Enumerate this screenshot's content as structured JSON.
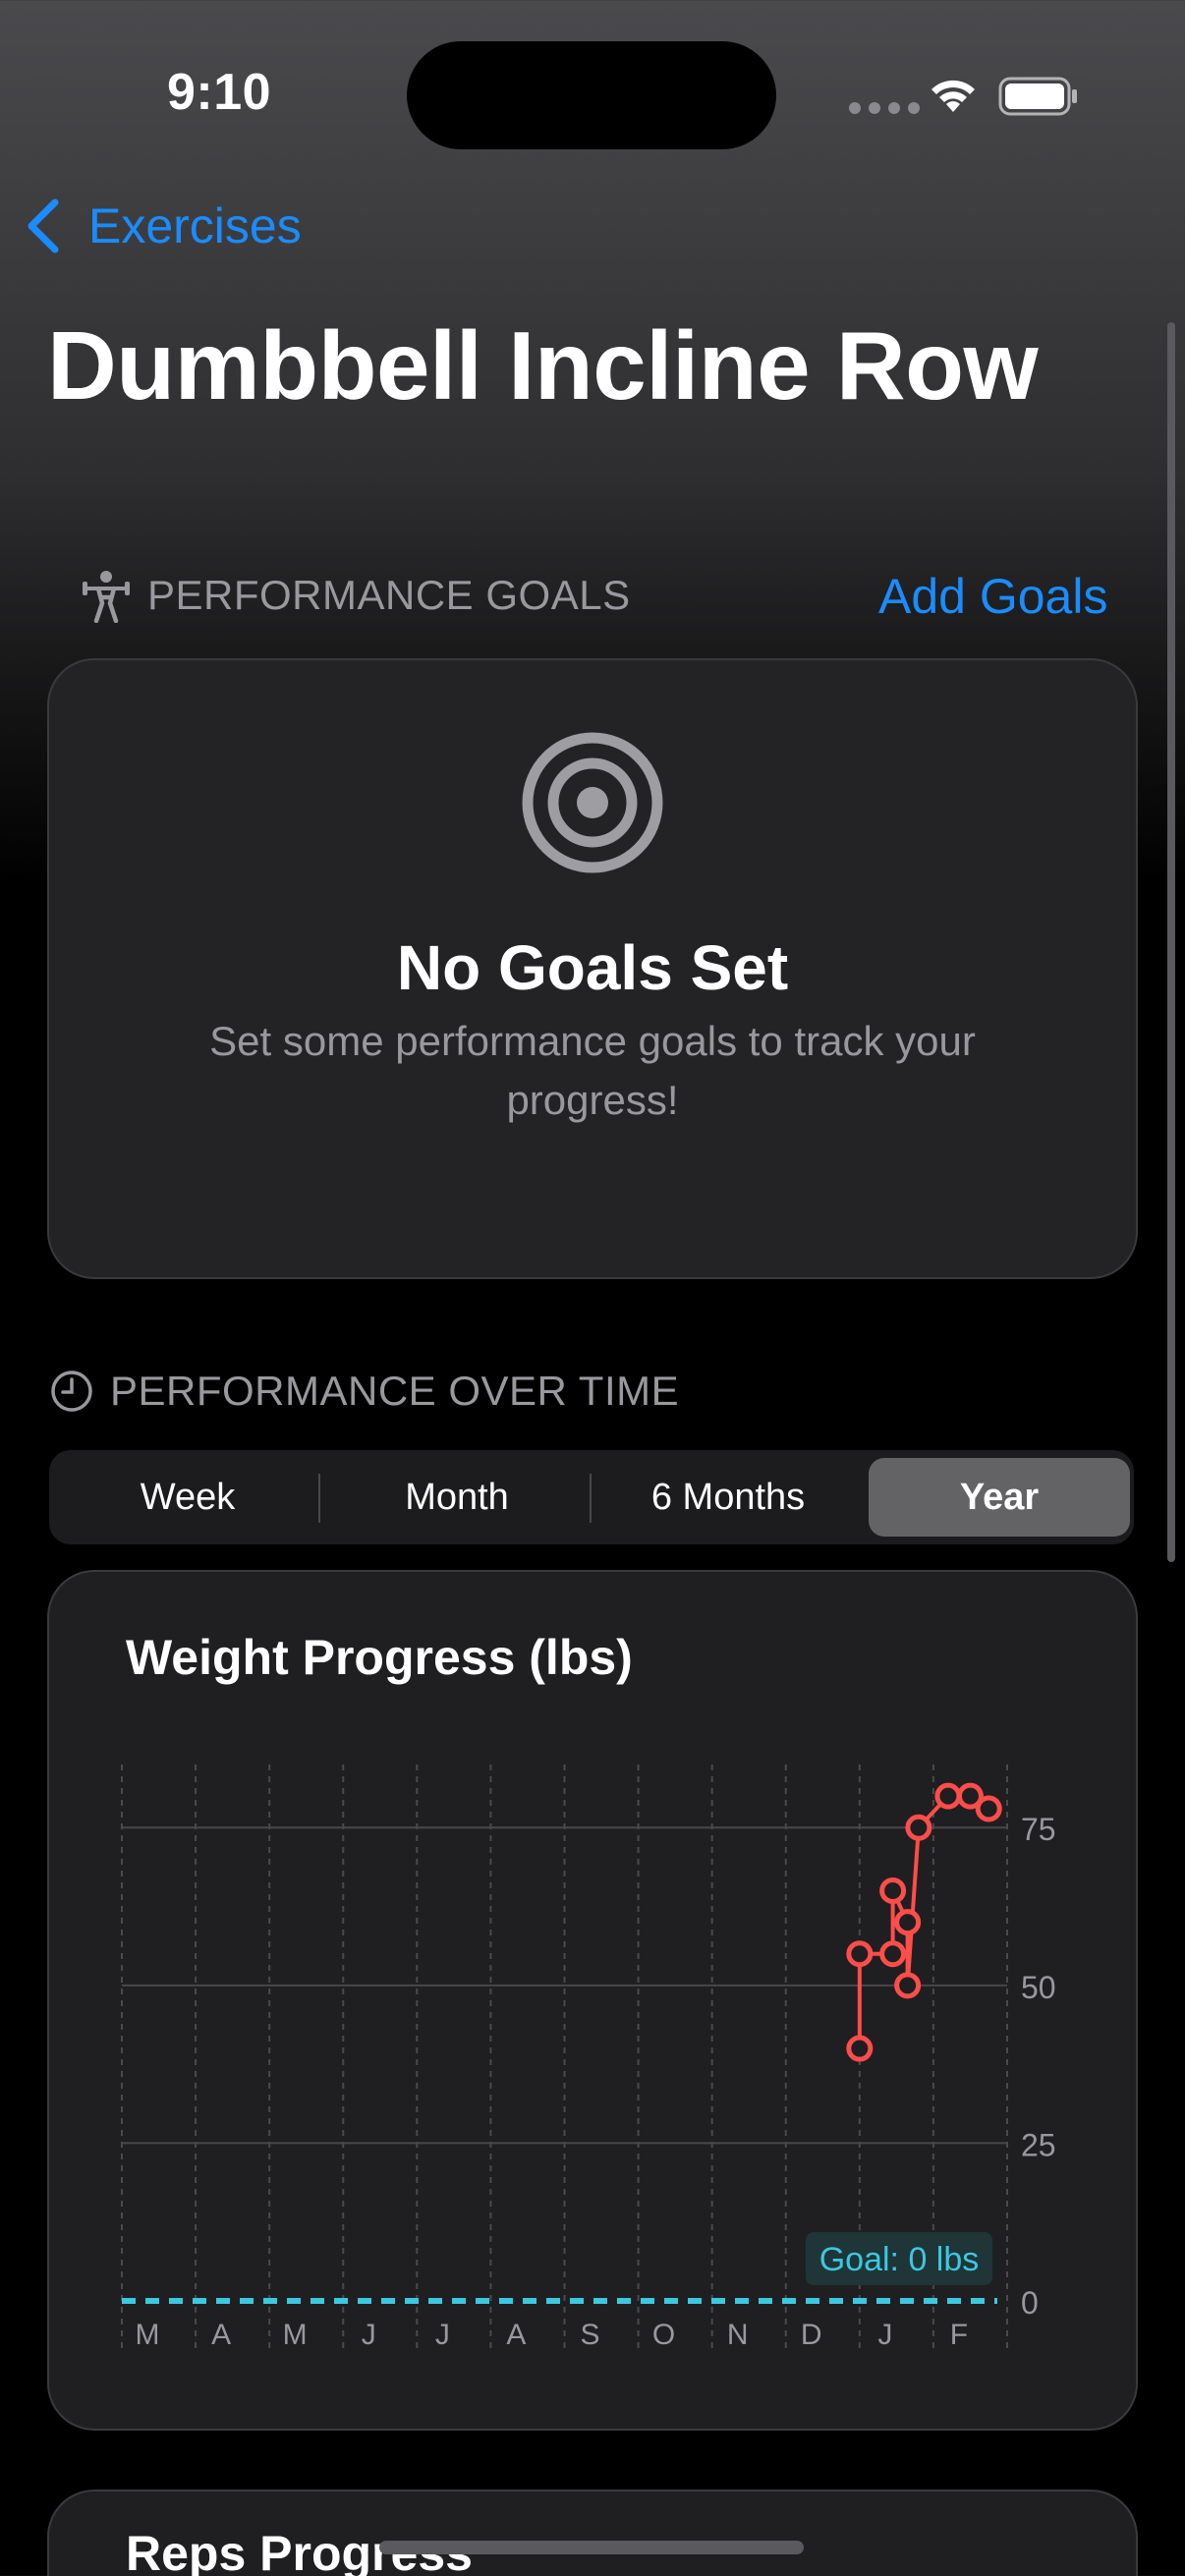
{
  "status_bar": {
    "time": "9:10",
    "icons": [
      "cellular-icon",
      "wifi-icon",
      "battery-icon"
    ]
  },
  "nav": {
    "back_label": "Exercises",
    "back_icon": "chevron-left-icon"
  },
  "page": {
    "title": "Dumbbell Incline Row"
  },
  "goals_section": {
    "header": "PERFORMANCE GOALS",
    "header_icon": "weightlifter-icon",
    "action_label": "Add Goals",
    "empty_icon": "target-icon",
    "empty_title": "No Goals Set",
    "empty_subtitle": "Set some performance goals to track your progress!"
  },
  "performance_section": {
    "header": "PERFORMANCE OVER TIME",
    "header_icon": "clock-icon",
    "segments": [
      {
        "label": "Week",
        "selected": false
      },
      {
        "label": "Month",
        "selected": false
      },
      {
        "label": "6 Months",
        "selected": false
      },
      {
        "label": "Year",
        "selected": true
      }
    ]
  },
  "colors": {
    "accent": "#1a8cff",
    "series": "#ff4d4a",
    "goal_line": "#3cc8e0",
    "secondary_text": "#98989d"
  },
  "chart_data": {
    "type": "line",
    "title": "Weight Progress (lbs)",
    "x_ticks": [
      "M",
      "A",
      "M",
      "J",
      "J",
      "A",
      "S",
      "O",
      "N",
      "D",
      "J",
      "F"
    ],
    "y_ticks": [
      0,
      25,
      50,
      75
    ],
    "ylim": [
      0,
      85
    ],
    "grid": true,
    "goal": {
      "value": 0,
      "label": "Goal: 0 lbs"
    },
    "series": [
      {
        "x": [
          10.0,
          10.0,
          10.45,
          10.45,
          10.65,
          10.65,
          10.8,
          11.2,
          11.5,
          11.75
        ],
        "y": [
          40,
          55,
          55,
          65,
          60,
          50,
          75,
          80,
          80,
          78
        ]
      }
    ]
  },
  "reps_section": {
    "title": "Reps Progress"
  }
}
